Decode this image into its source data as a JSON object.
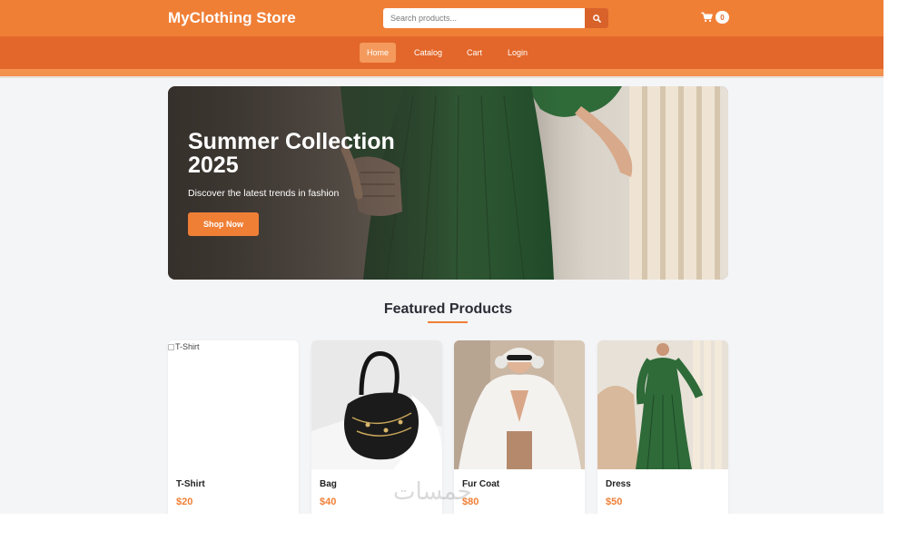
{
  "header": {
    "brand": "MyClothing Store",
    "search_placeholder": "Search products...",
    "search_icon": "search-icon",
    "cart_icon": "cart-icon",
    "cart_count": "0"
  },
  "nav": {
    "items": [
      {
        "label": "Home",
        "active": true
      },
      {
        "label": "Catalog",
        "active": false
      },
      {
        "label": "Cart",
        "active": false
      },
      {
        "label": "Login",
        "active": false
      }
    ]
  },
  "hero": {
    "title": "Summer Collection 2025",
    "subtitle": "Discover the latest trends in fashion",
    "button": "Shop Now"
  },
  "featured": {
    "title": "Featured Products",
    "products": [
      {
        "name": "T-Shirt",
        "price": "$20",
        "image_alt": "T-Shirt"
      },
      {
        "name": "Bag",
        "price": "$40"
      },
      {
        "name": "Fur Coat",
        "price": "$80"
      },
      {
        "name": "Dress",
        "price": "$50"
      }
    ]
  },
  "watermark": "خمسات",
  "colors": {
    "primary": "#f07f36",
    "nav": "#e3672a",
    "background": "#f4f5f7"
  }
}
